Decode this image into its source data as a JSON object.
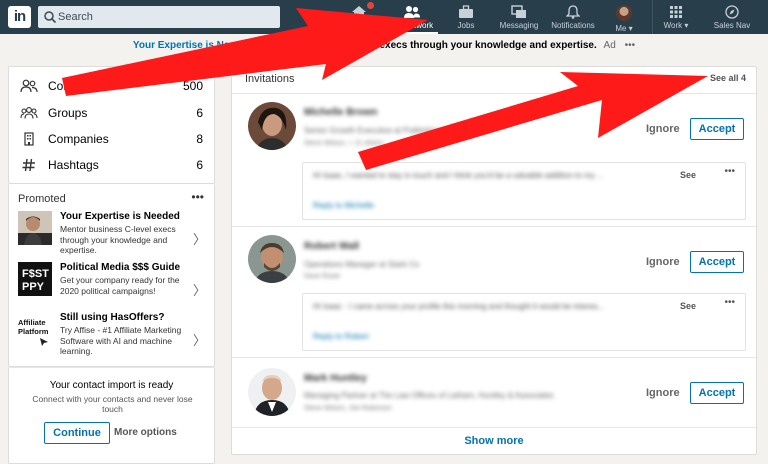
{
  "nav": {
    "logo": "in",
    "search_placeholder": "Search",
    "items": [
      {
        "label": "Home",
        "icon": "home-icon"
      },
      {
        "label": "My Network",
        "icon": "network-icon"
      },
      {
        "label": "Jobs",
        "icon": "briefcase-icon"
      },
      {
        "label": "Messaging",
        "icon": "messaging-icon"
      },
      {
        "label": "Notifications",
        "icon": "bell-icon"
      },
      {
        "label": "Me ▾",
        "icon": "avatar"
      },
      {
        "label": "Work ▾",
        "icon": "grid-icon"
      },
      {
        "label": "Sales Nav",
        "icon": "compass-icon"
      }
    ]
  },
  "ad_banner": {
    "title": "Your Expertise is Needed -",
    "text": "Mentor business C-level execs through your knowledge and expertise.",
    "tag": "Ad",
    "more": "•••"
  },
  "network_stats": [
    {
      "label": "Connections",
      "count": "500",
      "icon": "people-icon"
    },
    {
      "label": "Groups",
      "count": "6",
      "icon": "groups-icon"
    },
    {
      "label": "Companies",
      "count": "8",
      "icon": "building-icon"
    },
    {
      "label": "Hashtags",
      "count": "6",
      "icon": "hashtag-icon"
    }
  ],
  "promoted": {
    "heading": "Promoted",
    "more": "•••",
    "items": [
      {
        "title": "Your Expertise is Needed",
        "desc": "Mentor business C-level execs through your knowledge and expertise."
      },
      {
        "title": "Political Media $$$ Guide",
        "desc": "Get your company ready for the 2020 political campaigns!",
        "logo_text": "F$ST PPY"
      },
      {
        "title": "Still using HasOffers?",
        "desc": "Try Affise - #1 Affiliate Marketing Software with AI and machine learning.",
        "logo_text": "Affiliate Platform"
      }
    ]
  },
  "contact_import": {
    "title": "Your contact import is ready",
    "subtitle": "Connect with your contacts and never lose touch",
    "continue_label": "Continue",
    "more_label": "More options"
  },
  "invitations": {
    "heading": "Invitations",
    "see_all": "See all 4",
    "ignore_label": "Ignore",
    "accept_label": "Accept",
    "see_label": "See",
    "show_more": "Show more",
    "items": [
      {
        "name": "Michelle Brown",
        "title": "Senior Growth Executive at Publishing",
        "mutual": "Steve Wilson, + 11 others",
        "message": "Hi Isaac, I wanted to stay in touch and I think you'd be a valuable addition to my ...",
        "reply": "Reply to Michelle"
      },
      {
        "name": "Robert Wall",
        "title": "Operations Manager at Stark Co",
        "mutual": "Dave Rowe",
        "message": "Hi Isaac - I came across your profile this morning and thought it would be interes...",
        "reply": "Reply to Robert"
      },
      {
        "name": "Mark Huntley",
        "title": "Managing Partner at The Law Offices of Latham, Huntley & Associates",
        "mutual": "Steve Wilson, Joe Robinson",
        "message": "",
        "reply": ""
      }
    ]
  },
  "colors": {
    "nav_bg": "#283e4a",
    "brand_blue": "#0073b1",
    "annotation_arrow": "#ff1a1a"
  }
}
